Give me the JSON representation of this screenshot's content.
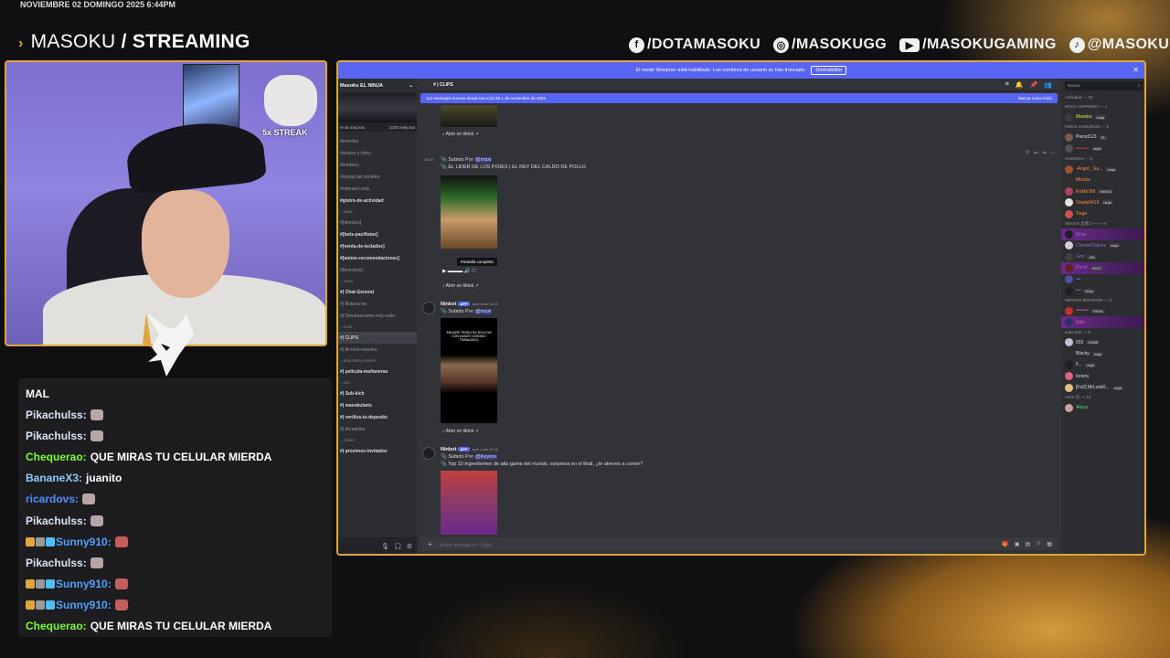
{
  "overlay": {
    "datetime": "NOVIEMBRE 02 DOMINGO 2025 6:44PM",
    "brand_part1": "MASOKU",
    "brand_sep": " / ",
    "brand_part2": "STREAMING",
    "socials": [
      {
        "icon": "facebook-icon",
        "glyph": "f",
        "handle": "/DOTAMASOKU"
      },
      {
        "icon": "instagram-icon",
        "glyph": "◎",
        "handle": "/MASOKUGG"
      },
      {
        "icon": "youtube-icon",
        "glyph": "▶",
        "handle": "/MASOKUGAMING"
      },
      {
        "icon": "tiktok-icon",
        "glyph": "♪",
        "handle": "@MASOKUGG"
      }
    ],
    "streak_label": "5x STREAK",
    "accent": "#e0a63b"
  },
  "chat": [
    {
      "user": "",
      "color": "#ffffff",
      "text": "MAL",
      "emote": ""
    },
    {
      "user": "Pikachulss:",
      "color": "#d9e4f2",
      "text": "",
      "emote": "grey"
    },
    {
      "user": "Pikachulss:",
      "color": "#d9e4f2",
      "text": "",
      "emote": "grey"
    },
    {
      "user": "Chequerao:",
      "color": "#7cfc3c",
      "text": "QUE MIRAS TU CELULAR MIERDA",
      "emote": ""
    },
    {
      "user": "BananeX3:",
      "color": "#8ec8ff",
      "text": "juanito",
      "emote": ""
    },
    {
      "user": "ricardovs:",
      "color": "#4f8fff",
      "text": "",
      "emote": "grey"
    },
    {
      "user": "Pikachulss:",
      "color": "#d9e4f2",
      "text": "",
      "emote": "grey"
    },
    {
      "user": "Sunny910:",
      "color": "#4fa0ff",
      "text": "",
      "emote": "red",
      "badges": true
    },
    {
      "user": "Pikachulss:",
      "color": "#d9e4f2",
      "text": "",
      "emote": "grey"
    },
    {
      "user": "Sunny910:",
      "color": "#4fa0ff",
      "text": "",
      "emote": "red",
      "badges": true
    },
    {
      "user": "Sunny910:",
      "color": "#4fa0ff",
      "text": "",
      "emote": "red",
      "badges": true
    },
    {
      "user": "Chequerao:",
      "color": "#7cfc3c",
      "text": "QUE MIRAS TU CELULAR MIERDA",
      "emote": ""
    }
  ],
  "discord": {
    "banner_text": "El modo Streamer está habilitado. Los nombres de usuario se han truncado.",
    "banner_button": "Deshabilitar",
    "guild_name": "Masoku EL NINJA",
    "boost_left": "el de mejoras",
    "boost_right": "10/20 Mejoras",
    "channels": [
      {
        "label": "eventos",
        "style": "plain"
      },
      {
        "label": "anales y roles",
        "style": "plain"
      },
      {
        "label": "iembros",
        "style": "plain"
      },
      {
        "label": "ejoras del servidor",
        "style": "plain"
      },
      {
        "label": "oderator-only",
        "style": "plain"
      },
      {
        "label": "gistro-de-actividad",
        "style": "white"
      },
      {
        "label": "ados",
        "style": "cat"
      },
      {
        "label": "[directos]",
        "style": "plain"
      },
      {
        "label": "[bots-pacifistas]",
        "style": "white"
      },
      {
        "label": "[venta-de-teclados]",
        "style": "white"
      },
      {
        "label": "[anime-recomendaciones]",
        "style": "white"
      },
      {
        "label": "[test-bots]",
        "style": "plain"
      },
      {
        "label": "neral",
        "style": "cat"
      },
      {
        "label": "| Chat-General",
        "style": "white"
      },
      {
        "label": "| Bota-tu-Ira",
        "style": "plain"
      },
      {
        "label": "| Desahunrame-only-subs",
        "style": "plain"
      },
      {
        "label": "rcola",
        "style": "cat"
      },
      {
        "label": "| CLIPS",
        "style": "active"
      },
      {
        "label": "| tik-toks-masoku",
        "style": "plain"
      },
      {
        "label": "DEPORTES-Y-TRAINER",
        "style": "cat"
      },
      {
        "label": "| pelicula-mañaneras",
        "style": "white"
      },
      {
        "label": "cito",
        "style": "cat"
      },
      {
        "label": "| Sub-kick",
        "style": "white"
      },
      {
        "label": "| masokubets",
        "style": "white"
      },
      {
        "label": "| verifica-tu-deposito",
        "style": "white"
      },
      {
        "label": "| donatelos",
        "style": "plain"
      },
      {
        "label": "rcidos",
        "style": "cat"
      },
      {
        "label": "| proximos-invitados",
        "style": "white"
      }
    ],
    "channel_title": "CLIPS",
    "new_messages": "113 mensajes nuevos desde las 8:23 del 1 de noviembre de 2025",
    "mark_read": "Marcar como leído",
    "open_tiktok": "Abrir en tiktok",
    "uploaded_by": "Subido Por",
    "msg1_mention": "@maxi",
    "msg1_text": "EL LIDER DE LOS PIXIES | EL REY DEL CALDO DE POLLO",
    "msg1_time": "18:30",
    "tooltip": "Pantalla completa",
    "bot_name": "Ninbot",
    "bot_tag": "APP",
    "bot_time1": "ayer a las 18:23",
    "msg2_mention": "@maxi",
    "msg2_overlay": "ANDARE TENSO EN SOLCON CON DANZO DIVIDIDO TRABAJADO",
    "bot_time2": "ayer a las 16:36",
    "msg3_mention": "@Keyres",
    "msg3_text": "Top 10 ingredientes de alta gama del mundo, sorpresa en el final, ¿te atreves a comer?",
    "input_placeholder": "Enviar mensaje a # | clips",
    "search_placeholder": "Buscar",
    "members_header": "Actividad — 22",
    "member_groups": [
      {
        "title": "NINJA SUPREMO — 1",
        "members": [
          {
            "name": "Masoku",
            "color": "#f0e04a",
            "badge": "ninja",
            "av": "#3a3c42"
          }
        ]
      },
      {
        "title": "MODS SAMURAIS — 2",
        "members": [
          {
            "name": "Pierxd123",
            "color": "#dbdee1",
            "badge": "PL",
            "av": "#7a5a4a"
          },
          {
            "name": "••••••••",
            "color": "#e04040",
            "badge": "ninja",
            "av": "#505050"
          }
        ]
      },
      {
        "title": "SAMURAI — 6",
        "members": [
          {
            "name": "-Angel_ Ga...",
            "color": "#ff8a3c",
            "badge": "ninja",
            "av": "#a05030"
          },
          {
            "name": "Miracle",
            "color": "#ff8a3c",
            "badge": "",
            "av": "#303030"
          },
          {
            "name": "RoMeOM",
            "color": "#ff8a3c",
            "badge": "NINDO",
            "av": "#b04060"
          },
          {
            "name": "Shady9419",
            "color": "#ff8a3c",
            "badge": "ninja",
            "av": "#e0e0e0"
          },
          {
            "name": "Tiago",
            "color": "#ff8a3c",
            "badge": "",
            "av": "#d05050"
          }
        ]
      },
      {
        "title": "NINJAS 忍者ジー — 6",
        "members": [
          {
            "name": "Shae",
            "color": "#9a6ad8",
            "badge": "",
            "av": "#202020",
            "hl": true
          },
          {
            "name": "ChemeChavez",
            "color": "#9a6ad8",
            "badge": "ninja",
            "av": "#d0d0d0"
          },
          {
            "name": "Grei",
            "color": "#9a6ad8",
            "badge": "ZIN",
            "av": "#404040"
          },
          {
            "name": "Puchi",
            "color": "#9a6ad8",
            "badge": "RATZ",
            "av": "#602020",
            "hl": true
          },
          {
            "name": "•••",
            "color": "#9a6ad8",
            "badge": "",
            "av": "#5050a0"
          },
          {
            "name": "•••",
            "color": "#9a6ad8",
            "badge": "ninja",
            "av": "#202020"
          }
        ]
      },
      {
        "title": "SERVER BOOSTER — 2",
        "members": [
          {
            "name": "••••••••",
            "color": "#e060c0",
            "badge": "FERA",
            "av": "#c03030"
          },
          {
            "name": "Solo",
            "color": "#e060c0",
            "badge": "",
            "av": "#303060",
            "hl": true
          }
        ]
      },
      {
        "title": "subs kick — 5",
        "members": [
          {
            "name": "002",
            "color": "#dbdee1",
            "badge": "KAIMI",
            "av": "#c0c0d0"
          },
          {
            "name": "Blacky",
            "color": "#dbdee1",
            "badge": "ninja",
            "av": "#303030"
          },
          {
            "name": "F...",
            "color": "#dbdee1",
            "badge": "ninja",
            "av": "#202020"
          },
          {
            "name": "toneru",
            "color": "#dbdee1",
            "badge": "",
            "av": "#e06080"
          },
          {
            "name": "[FaZ] MrLuisEl...",
            "color": "#dbdee1",
            "badge": "ninja",
            "av": "#e0c080"
          }
        ]
      },
      {
        "title": "ANIS 忍 — 13",
        "members": [
          {
            "name": "Alejus",
            "color": "#5ad86a",
            "badge": "",
            "av": "#d0a0a0"
          }
        ]
      }
    ]
  }
}
